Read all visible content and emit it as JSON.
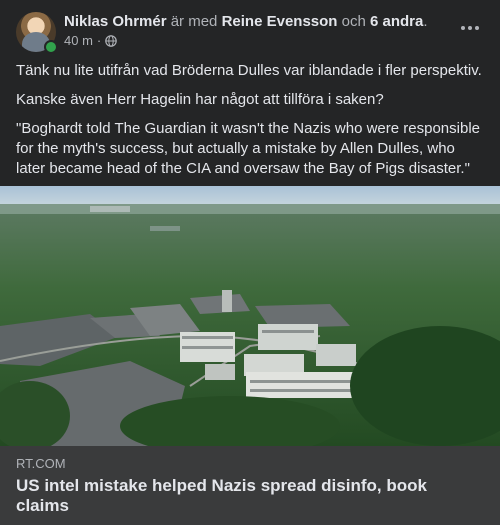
{
  "post": {
    "author": "Niklas Ohrmér",
    "with_text": "är med",
    "tagged": "Reine Evensson",
    "and_text": "och",
    "others": "6 andra",
    "period": ".",
    "time": "40 m",
    "separator": "·",
    "audience_icon": "globe-icon",
    "more_icon": "more-options-icon"
  },
  "body": {
    "p1": "Tänk nu lite utifrån vad Bröderna Dulles var iblandade i fler perspektiv.",
    "p2": "Kanske även Herr Hagelin har något att tillföra i saken?",
    "p3": "\"Boghardt told The Guardian it wasn't the Nazis who were responsible for the myth's success, but actually a mistake by Allen Dulles, who later became head of the CIA and oversaw the Bay of Pigs disaster.\""
  },
  "link": {
    "domain": "RT.COM",
    "title": "US intel mistake helped Nazis spread disinfo, book claims"
  },
  "colors": {
    "background": "#242526",
    "card": "#3a3b3c",
    "online": "#31a24c"
  }
}
